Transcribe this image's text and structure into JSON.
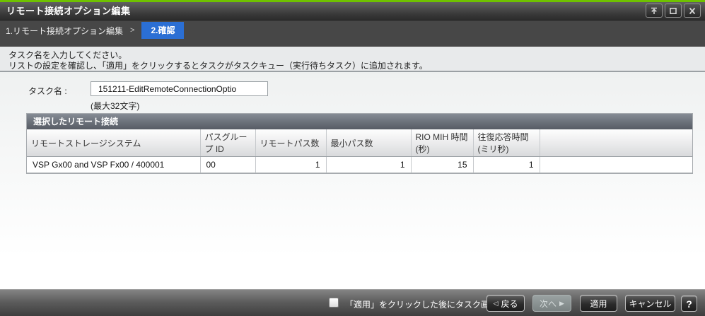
{
  "window": {
    "title": "リモート接続オプション編集",
    "controls": {
      "rollup_icon": "collapse-to-top-icon",
      "maximize_icon": "maximize-icon",
      "close_icon": "close-icon"
    }
  },
  "breadcrumb": {
    "step1": "1.リモート接続オプション編集",
    "separator": ">",
    "step2_current": "2.確認"
  },
  "instructions": {
    "line1": "タスク名を入力してください。",
    "line2": "リストの設定を確認し、「適用」をクリックするとタスクがタスクキュー（実行待ちタスク）に追加されます。"
  },
  "task": {
    "label": "タスク名 :",
    "value": "151211-EditRemoteConnectionOptio",
    "hint": "(最大32文字)"
  },
  "table": {
    "title": "選択したリモート接続",
    "columns": [
      "リモートストレージシステム",
      "パスグループ ID",
      "リモートパス数",
      "最小パス数",
      "RIO MIH 時間 (秒)",
      "往復応答時間 (ミリ秒)",
      ""
    ],
    "rows": [
      [
        "VSP Gx00 and VSP Fx00 / 400001",
        "00",
        "1",
        "1",
        "15",
        "1",
        ""
      ]
    ]
  },
  "footer": {
    "checkbox_label": "「適用」をクリックした後にタスク画面を表示",
    "checkbox_checked": false,
    "back_label": "戻る",
    "back_arrow": "◁",
    "next_label": "次へ",
    "next_arrow": "▶",
    "next_enabled": false,
    "apply_label": "適用",
    "cancel_label": "キャンセル",
    "help_label": "?"
  },
  "colors": {
    "accent_green": "#6fc100",
    "badge_blue": "#2b6fd4",
    "titlebar_dark": "#383838",
    "table_header_slate": "#6a7079"
  }
}
